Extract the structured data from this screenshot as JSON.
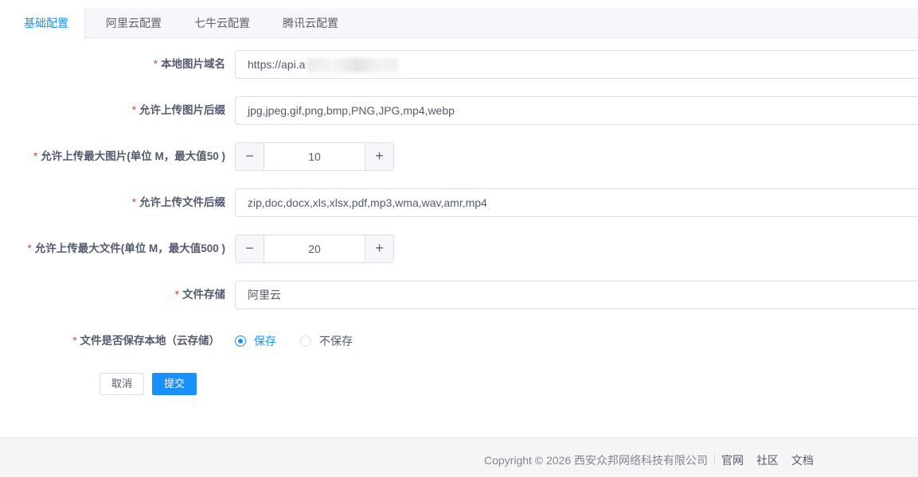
{
  "tabs": [
    {
      "label": "基础配置",
      "active": true
    },
    {
      "label": "阿里云配置",
      "active": false
    },
    {
      "label": "七牛云配置",
      "active": false
    },
    {
      "label": "腾讯云配置",
      "active": false
    }
  ],
  "required_mark": "*",
  "form": {
    "local_domain": {
      "label": "本地图片域名",
      "value": "https://api.a"
    },
    "image_ext": {
      "label": "允许上传图片后缀",
      "value": "jpg,jpeg,gif,png,bmp,PNG,JPG,mp4,webp"
    },
    "image_max": {
      "label": "允许上传最大图片(单位 M，最大值50 )",
      "value": "10",
      "minus": "−",
      "plus": "+"
    },
    "file_ext": {
      "label": "允许上传文件后缀",
      "value": "zip,doc,docx,xls,xlsx,pdf,mp3,wma,wav,amr,mp4"
    },
    "file_max": {
      "label": "允许上传最大文件(单位 M，最大值500 )",
      "value": "20",
      "minus": "−",
      "plus": "+"
    },
    "storage": {
      "label": "文件存储",
      "value": "阿里云"
    },
    "save_local": {
      "label": "文件是否保存本地（云存储）",
      "options": [
        {
          "label": "保存",
          "checked": true
        },
        {
          "label": "不保存",
          "checked": false
        }
      ]
    }
  },
  "actions": {
    "cancel": "取消",
    "submit": "提交"
  },
  "footer": {
    "copyright": "Copyright © 2026 西安众邦网络科技有限公司",
    "links": [
      "官网",
      "社区",
      "文档"
    ]
  },
  "colors": {
    "accent": "#1890ff",
    "required": "#ed4014",
    "text": "#515a6e",
    "border": "#dcdee2"
  }
}
